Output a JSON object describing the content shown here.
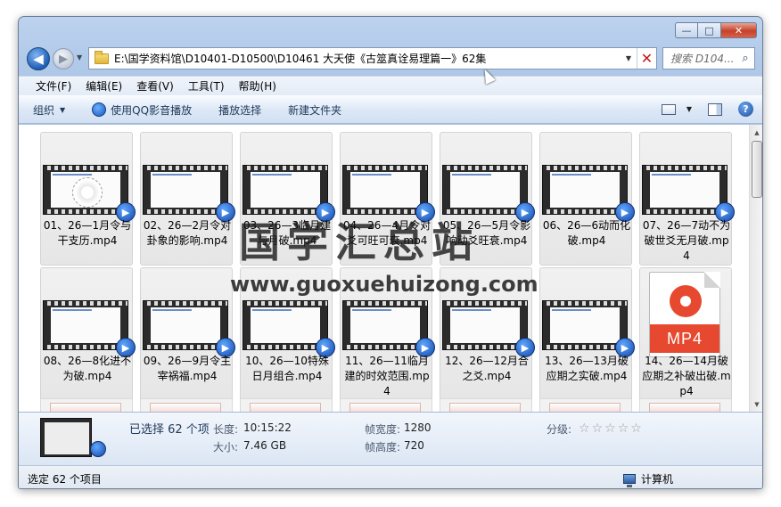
{
  "window": {
    "buttons": {
      "minimize": "—",
      "maximize": "□",
      "close": "✕"
    }
  },
  "nav": {
    "back": "◀",
    "forward": "▶",
    "dropdown": "▼"
  },
  "address": {
    "path": "E:\\国学资料馆\\D10401-D10500\\D10461 大天使《古筮真诠易理篇一》62集",
    "dropdown": "▼",
    "stop": "✕"
  },
  "search": {
    "placeholder": "搜索 D104...",
    "icon": "⌕"
  },
  "menu": {
    "items": [
      "文件(F)",
      "编辑(E)",
      "查看(V)",
      "工具(T)",
      "帮助(H)"
    ]
  },
  "toolbar": {
    "organize": "组织",
    "organize_caret": "▼",
    "play_qq": "使用QQ影音播放",
    "play_select": "播放选择",
    "new_folder": "新建文件夹",
    "view_caret": "▼",
    "help": "?"
  },
  "files": [
    {
      "name": "01、26—1月令与干支历.mp4",
      "thumb": "dial"
    },
    {
      "name": "02、26—2月令对卦象的影响.mp4",
      "thumb": "video"
    },
    {
      "name": "03、26—3临月建与月破.mp4",
      "thumb": "video"
    },
    {
      "name": "04、26—4月令对爻可旺可衰.mp4",
      "thumb": "video"
    },
    {
      "name": "05、26—5月令影响动爻旺衰.mp4",
      "thumb": "video"
    },
    {
      "name": "06、26—6动而化破.mp4",
      "thumb": "video"
    },
    {
      "name": "07、26—7动不为破世爻无月破.mp4",
      "thumb": "video"
    },
    {
      "name": "08、26—8化进不为破.mp4",
      "thumb": "video"
    },
    {
      "name": "09、26—9月令主宰祸福.mp4",
      "thumb": "video"
    },
    {
      "name": "10、26—10特殊日月组合.mp4",
      "thumb": "video"
    },
    {
      "name": "11、26—11临月建的时效范围.mp4",
      "thumb": "video"
    },
    {
      "name": "12、26—12月合之爻.mp4",
      "thumb": "video"
    },
    {
      "name": "13、26—13月破应期之实破.mp4",
      "thumb": "video"
    },
    {
      "name": "14、26—14月破应期之补破出破.mp4",
      "thumb": "mp4"
    }
  ],
  "mp4_label": "MP4",
  "badge_glyph": "▶",
  "scroll": {
    "up": "▲",
    "down": "▼"
  },
  "details": {
    "selected": "已选择 62 个项",
    "length_label": "长度:",
    "length": "10:15:22",
    "size_label": "大小:",
    "size": "7.46 GB",
    "width_label": "帧宽度:",
    "width": "1280",
    "height_label": "帧高度:",
    "height": "720",
    "rating_label": "分级:",
    "stars": [
      "☆",
      "☆",
      "☆",
      "☆",
      "☆"
    ]
  },
  "status": {
    "left": "选定 62 个项目",
    "right": "计算机"
  },
  "watermark": {
    "title": "国学汇总站",
    "url": "www.guoxuehuizong.com"
  }
}
